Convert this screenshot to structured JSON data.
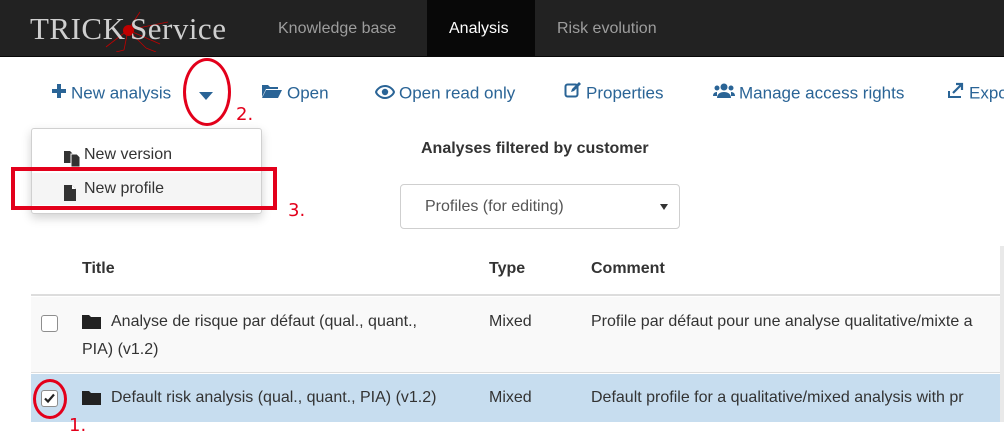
{
  "navbar": {
    "brand_left": "TRICK",
    "brand_right": "Service",
    "items": [
      {
        "label": "Knowledge base",
        "active": false
      },
      {
        "label": "Analysis",
        "active": true
      },
      {
        "label": "Risk evolution",
        "active": false
      }
    ]
  },
  "toolbar": {
    "new_analysis": "New analysis",
    "open": "Open",
    "open_read_only": "Open read only",
    "properties": "Properties",
    "manage_access_rights": "Manage access rights",
    "export": "Expo"
  },
  "dropdown": {
    "new_version": "New version",
    "new_profile": "New profile"
  },
  "filter": {
    "title": "Analyses filtered by customer",
    "selected": "Profiles (for editing)"
  },
  "table": {
    "headers": {
      "title": "Title",
      "type": "Type",
      "comment": "Comment"
    },
    "rows": [
      {
        "title_line1": "Analyse de risque par défaut (qual., quant.,",
        "title_line2": "PIA) (v1.2)",
        "type": "Mixed",
        "comment": "Profile par défaut pour une analyse qualitative/mixte a",
        "checked": false
      },
      {
        "title_line1": "Default risk analysis (qual., quant., PIA) (v1.2)",
        "type": "Mixed",
        "comment": "Default profile for a qualitative/mixed analysis with pr",
        "checked": true
      }
    ]
  },
  "annotations": {
    "step1": "1.",
    "step2": "2.",
    "step3": "3."
  },
  "colors": {
    "navbar_bg": "#222222",
    "link_blue": "#2a6496",
    "selected_row": "#c7ddef",
    "annotation_red": "#e3001b"
  }
}
